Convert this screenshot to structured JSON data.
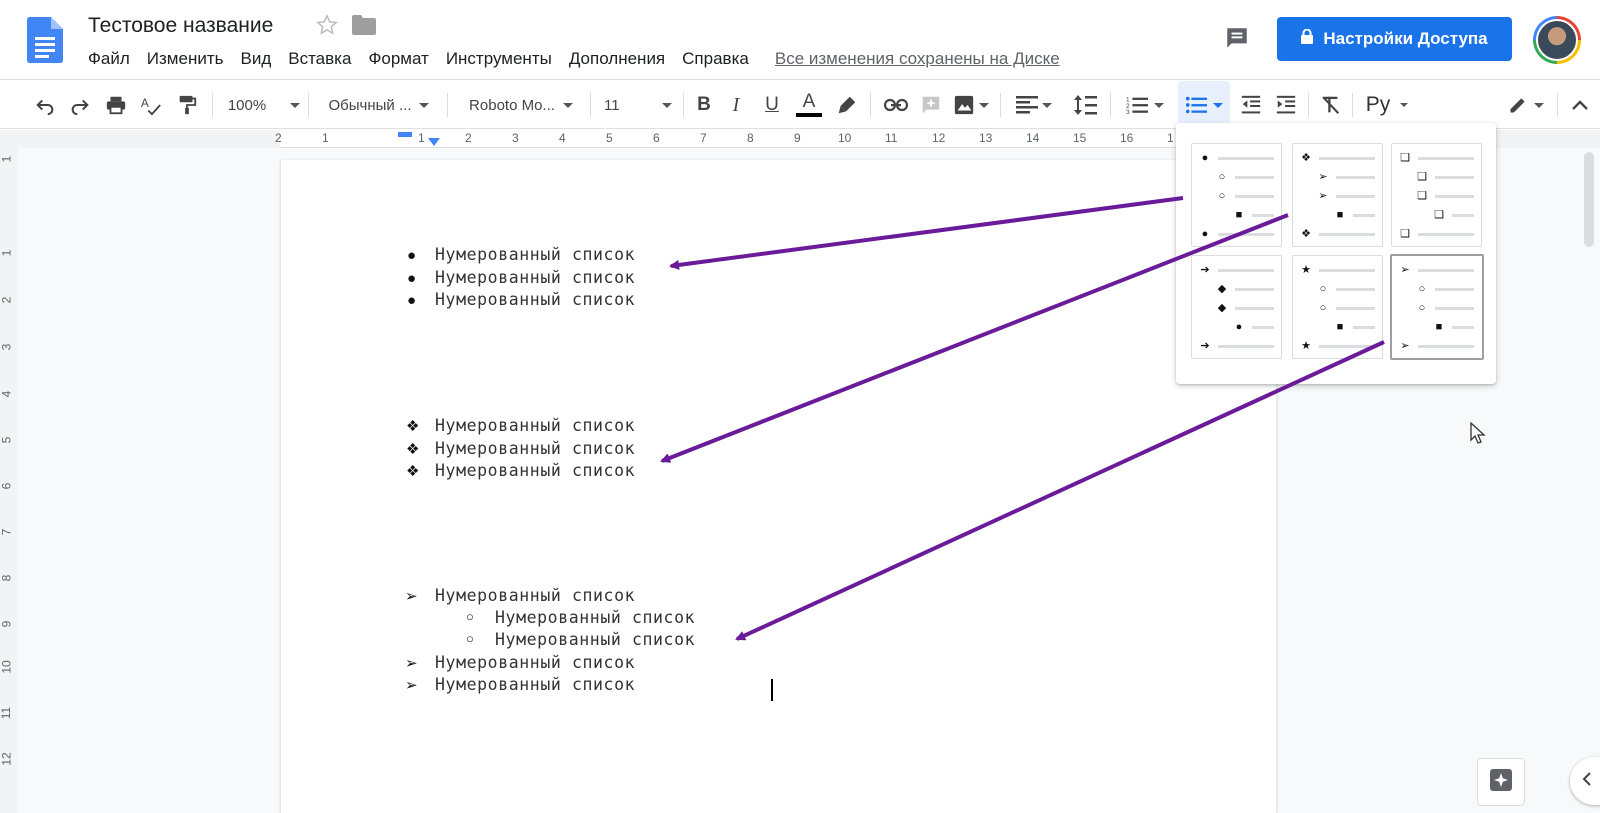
{
  "header": {
    "title": "Тестовое название",
    "menu": [
      "Файл",
      "Изменить",
      "Вид",
      "Вставка",
      "Формат",
      "Инструменты",
      "Дополнения",
      "Справка"
    ],
    "saved_status": "Все изменения сохранены на Диске",
    "share_label": "Настройки Доступа"
  },
  "toolbar": {
    "zoom": "100%",
    "style": "Обычный ...",
    "font": "Roboto Mo...",
    "size": "11",
    "input_lang": "Ру"
  },
  "ruler": {
    "h_labels": [
      "2",
      "1",
      "1",
      "2",
      "3",
      "4",
      "5",
      "6",
      "7",
      "8",
      "9",
      "10",
      "11",
      "12",
      "13",
      "14",
      "15",
      "16",
      "1"
    ],
    "v_labels": [
      "1",
      "1",
      "2",
      "3",
      "4",
      "5",
      "6",
      "7",
      "8",
      "9",
      "10",
      "11",
      "12"
    ]
  },
  "document": {
    "list1": [
      {
        "bullet": "●",
        "text": "Нумерованный список"
      },
      {
        "bullet": "●",
        "text": "Нумерованный список"
      },
      {
        "bullet": "●",
        "text": "Нумерованный список"
      }
    ],
    "list2": [
      {
        "bullet": "❖",
        "text": "Нумерованный список"
      },
      {
        "bullet": "❖",
        "text": "Нумерованный список"
      },
      {
        "bullet": "❖",
        "text": "Нумерованный список"
      }
    ],
    "list3": [
      {
        "bullet": "➢",
        "text": "Нумерованный список",
        "level": 0
      },
      {
        "bullet": "○",
        "text": "Нумерованный список",
        "level": 1
      },
      {
        "bullet": "○",
        "text": "Нумерованный список",
        "level": 1
      },
      {
        "bullet": "➢",
        "text": "Нумерованный список",
        "level": 0
      },
      {
        "bullet": "➢",
        "text": "Нумерованный список",
        "level": 0
      }
    ]
  },
  "bullet_menu": {
    "options": [
      {
        "name": "disc",
        "rows": [
          "●",
          "○",
          "○",
          "■",
          "●"
        ]
      },
      {
        "name": "diamond",
        "rows": [
          "❖",
          "➢",
          "➢",
          "■",
          "❖"
        ]
      },
      {
        "name": "box",
        "rows": [
          "❑",
          "❑",
          "❑",
          "❑",
          "❑"
        ]
      },
      {
        "name": "arrow",
        "rows": [
          "➔",
          "◆",
          "◆",
          "●",
          "➔"
        ]
      },
      {
        "name": "star",
        "rows": [
          "★",
          "○",
          "○",
          "■",
          "★"
        ]
      },
      {
        "name": "arrowhead",
        "rows": [
          "➢",
          "○",
          "○",
          "■",
          "➢"
        ],
        "selected": true
      }
    ]
  },
  "colors": {
    "accent": "#1a73e8",
    "annotation_arrow": "#6a1b9a"
  }
}
